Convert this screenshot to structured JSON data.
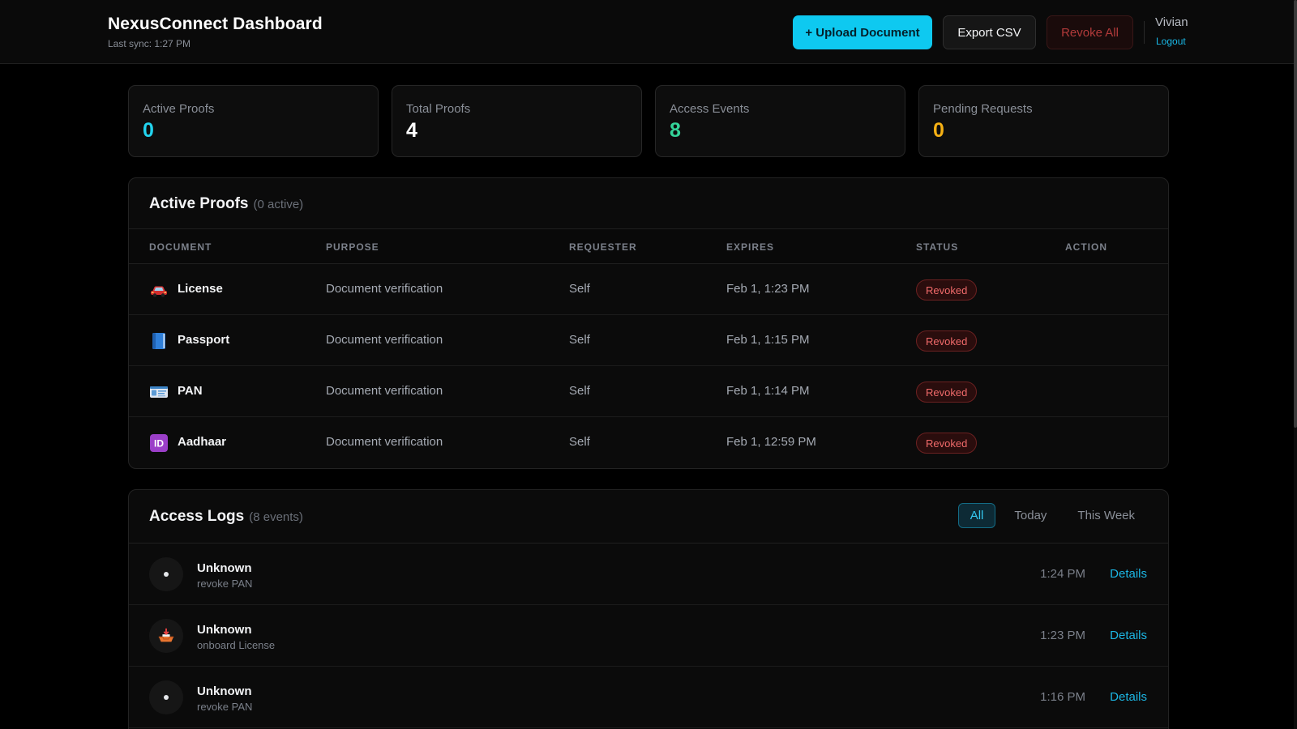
{
  "header": {
    "title": "NexusConnect Dashboard",
    "last_sync": "Last sync: 1:27 PM",
    "upload_label": "+ Upload Document",
    "export_label": "Export CSV",
    "revoke_all_label": "Revoke All",
    "user_name": "Vivian",
    "logout_label": "Logout"
  },
  "stats": [
    {
      "label": "Active Proofs",
      "value": "0",
      "color": "#22d3ee"
    },
    {
      "label": "Total Proofs",
      "value": "4",
      "color": "#ffffff"
    },
    {
      "label": "Access Events",
      "value": "8",
      "color": "#34d399"
    },
    {
      "label": "Pending Requests",
      "value": "0",
      "color": "#f5b014"
    }
  ],
  "active_proofs": {
    "title": "Active Proofs",
    "count_label": "(0 active)",
    "columns": [
      "DOCUMENT",
      "PURPOSE",
      "REQUESTER",
      "EXPIRES",
      "STATUS",
      "ACTION"
    ],
    "rows": [
      {
        "document": "License",
        "icon": "car-icon",
        "purpose": "Document verification",
        "requester": "Self",
        "expires": "Feb 1, 1:23 PM",
        "status": "Revoked"
      },
      {
        "document": "Passport",
        "icon": "blue-book-icon",
        "purpose": "Document verification",
        "requester": "Self",
        "expires": "Feb 1, 1:15 PM",
        "status": "Revoked"
      },
      {
        "document": "PAN",
        "icon": "id-card-icon",
        "purpose": "Document verification",
        "requester": "Self",
        "expires": "Feb 1, 1:14 PM",
        "status": "Revoked"
      },
      {
        "document": "Aadhaar",
        "icon": "id-button-icon",
        "id_text": "ID",
        "purpose": "Document verification",
        "requester": "Self",
        "expires": "Feb 1, 12:59 PM",
        "status": "Revoked"
      }
    ]
  },
  "access_logs": {
    "title": "Access Logs",
    "count_label": "(8 events)",
    "filters": [
      "All",
      "Today",
      "This Week"
    ],
    "active_filter": "All",
    "details_label": "Details",
    "entries": [
      {
        "actor": "Unknown",
        "action": "revoke PAN",
        "time": "1:24 PM",
        "icon": "dot-icon"
      },
      {
        "actor": "Unknown",
        "action": "onboard License",
        "time": "1:23 PM",
        "icon": "inbox-tray-icon"
      },
      {
        "actor": "Unknown",
        "action": "revoke PAN",
        "time": "1:16 PM",
        "icon": "dot-icon"
      }
    ]
  }
}
